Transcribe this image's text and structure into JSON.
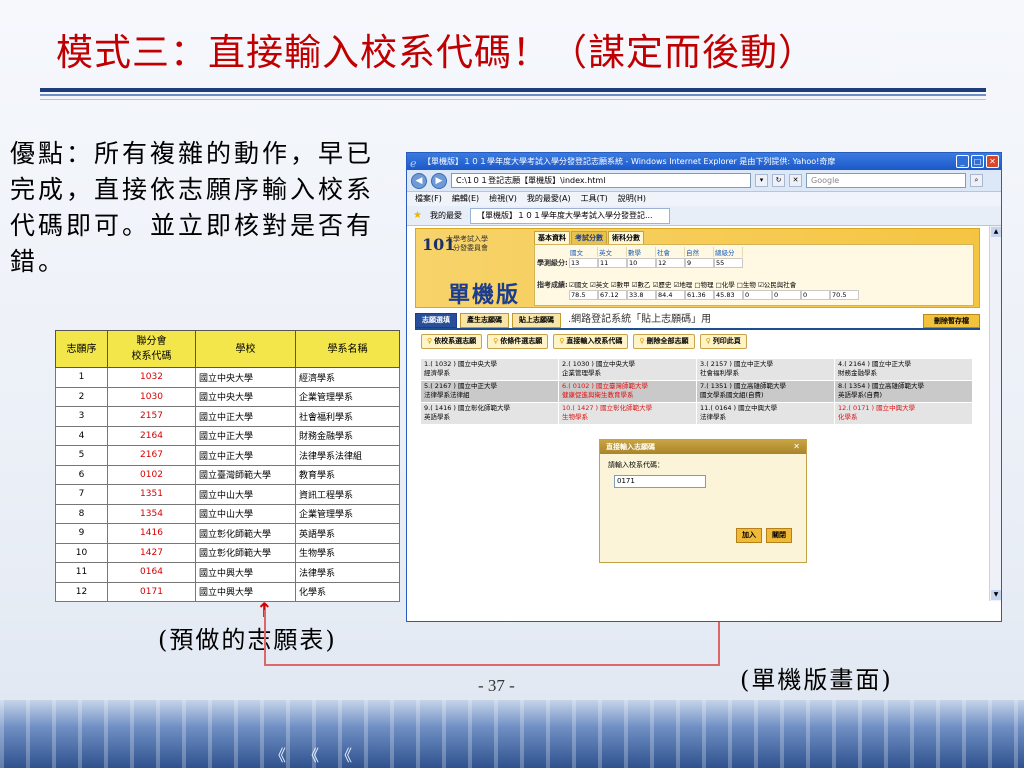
{
  "slide": {
    "title": "模式三：直接輸入校系代碼！（謀定而後動）",
    "advantage_text": "優點：所有複雜的動作，早已完成，直接依志願序輸入校系代碼即可。並立即核對是否有錯。",
    "caption_left": "(預做的志願表)",
    "caption_right": "(單機版畫面)",
    "page_number": "- 37 -",
    "footer_chevrons": "《 《 《"
  },
  "preference_table": {
    "headers": [
      "志願序",
      "聯分會\n校系代碼",
      "學校",
      "學系名稱"
    ],
    "rows": [
      [
        "1",
        "1032",
        "國立中央大學",
        "經濟學系"
      ],
      [
        "2",
        "1030",
        "國立中央大學",
        "企業管理學系"
      ],
      [
        "3",
        "2157",
        "國立中正大學",
        "社會福利學系"
      ],
      [
        "4",
        "2164",
        "國立中正大學",
        "財務金融學系"
      ],
      [
        "5",
        "2167",
        "國立中正大學",
        "法律學系法律組"
      ],
      [
        "6",
        "0102",
        "國立臺灣師範大學",
        "教育學系"
      ],
      [
        "7",
        "1351",
        "國立中山大學",
        "資訊工程學系"
      ],
      [
        "8",
        "1354",
        "國立中山大學",
        "企業管理學系"
      ],
      [
        "9",
        "1416",
        "國立彰化師範大學",
        "英語學系"
      ],
      [
        "10",
        "1427",
        "國立彰化師範大學",
        "生物學系"
      ],
      [
        "11",
        "0164",
        "國立中興大學",
        "法律學系"
      ],
      [
        "12",
        "0171",
        "國立中興大學",
        "化學系"
      ]
    ]
  },
  "browser": {
    "window_title": "【單機版】１０１學年度大學考試入學分發登記志願系統 - Windows Internet Explorer 是由下列提供: Yahoo!奇摩",
    "address": "C:\\1０１登記志願【單機版】\\index.html",
    "search_placeholder": "Google",
    "menu": [
      "檔案(F)",
      "編輯(E)",
      "檢視(V)",
      "我的最愛(A)",
      "工具(T)",
      "說明(H)"
    ],
    "favorites_label": "我的最愛",
    "tab_label": "【單機版】１０１學年度大學考試入學分發登記...",
    "app": {
      "logo": "101",
      "org": "大學考試入學\n　分發委員會",
      "name": "單機版",
      "score_tabs": [
        "基本資料",
        "考試分數",
        "術科分數"
      ],
      "score_label_1": "學測級分:",
      "score_label_2": "指考成績:",
      "gsat_subjects": [
        "國文",
        "英文",
        "數學",
        "社會",
        "自然",
        "總級分"
      ],
      "gsat_values": [
        "13",
        "11",
        "10",
        "12",
        "9",
        "55"
      ],
      "ast_values": [
        "78.5",
        "67.12",
        "33.8",
        "84.4",
        "61.36",
        "45.83",
        "0",
        "0",
        "0",
        "70.5"
      ],
      "ast_subjects": "☑國文 ☑英文 ☑數甲 ☑數乙 ☑歷史 ☑地理 □物理 □化學 □生物 ☑公民與社會",
      "wizard_tabs": [
        "志願選填",
        "產生志願碼",
        "貼上志願碼"
      ],
      "wizard_title": ".網路登記系統「貼上志願碼」用",
      "save_button": "刪除暫存檔",
      "actions": [
        "依校系選志願",
        "依條件選志願",
        "直接輸入校系代碼",
        "刪除全部志願",
        "列印此頁"
      ],
      "choices": [
        {
          "text": "1.( 1032 ) 國立中央大學\n經濟學系",
          "red": false
        },
        {
          "text": "2.( 1030 ) 國立中央大學\n企業管理學系",
          "red": false
        },
        {
          "text": "3.( 2157 ) 國立中正大學\n社會福利學系",
          "red": false
        },
        {
          "text": "4.( 2164 ) 國立中正大學\n財務金融學系",
          "red": false
        },
        {
          "text": "5.( 2167 ) 國立中正大學\n法律學系法律組",
          "red": false
        },
        {
          "text": "6.( 0102 ) 國立臺灣師範大學\n健康促進與衛生教育學系",
          "red": true
        },
        {
          "text": "7.( 1351 ) 國立高雄師範大學\n國文學系國文組(自費)",
          "red": false
        },
        {
          "text": "8.( 1354 ) 國立高雄師範大學\n英語學系(自費)",
          "red": false
        },
        {
          "text": "9.( 1416 ) 國立彰化師範大學\n英語學系",
          "red": false
        },
        {
          "text": "10.( 1427 ) 國立彰化師範大學\n生物學系",
          "red": true
        },
        {
          "text": "11.( 0164 ) 國立中興大學\n法律學系",
          "red": false
        },
        {
          "text": "12.( 0171 ) 國立中興大學\n化學系",
          "red": true
        }
      ],
      "dialog": {
        "title": "直接輸入志願碼",
        "label": "請輸入校系代碼：",
        "input_value": "0171",
        "add_button": "加入",
        "close_button": "關閉"
      }
    }
  },
  "colors": {
    "title_red": "#c00000",
    "code_red": "#d40000",
    "table_header": "#f2e64a",
    "ie_blue": "#1c58c9"
  }
}
